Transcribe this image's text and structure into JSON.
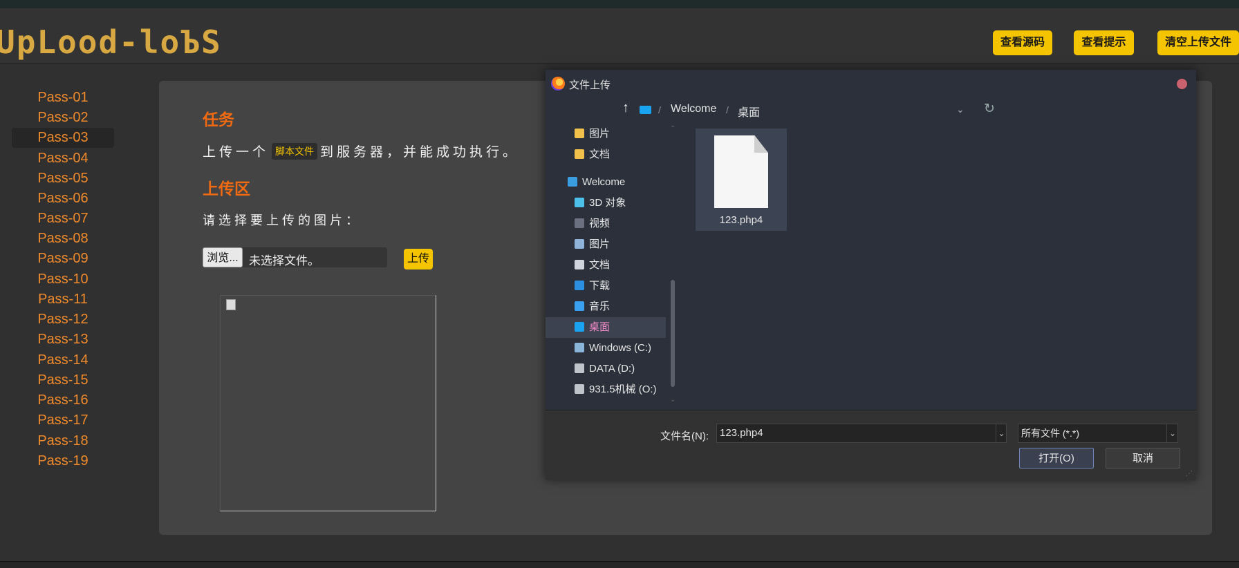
{
  "app": {
    "logo_text": "UpLood-loЪS"
  },
  "header": {
    "buttons": [
      "查看源码",
      "查看提示",
      "清空上传文件"
    ]
  },
  "sidebar": {
    "items": [
      "Pass-01",
      "Pass-02",
      "Pass-03",
      "Pass-04",
      "Pass-05",
      "Pass-06",
      "Pass-07",
      "Pass-08",
      "Pass-09",
      "Pass-10",
      "Pass-11",
      "Pass-12",
      "Pass-13",
      "Pass-14",
      "Pass-15",
      "Pass-16",
      "Pass-17",
      "Pass-18",
      "Pass-19"
    ],
    "active": "Pass-03"
  },
  "main": {
    "task_heading": "任务",
    "task_before": "上传一个",
    "task_code": "脚本文件",
    "task_after": "到服务器，并能成功执行。",
    "upload_heading": "上传区",
    "select_prompt": "请选择要上传的图片：",
    "browse_label": "浏览...",
    "file_status": "未选择文件。",
    "upload_button": "上传"
  },
  "dialog": {
    "title": "文件上传",
    "address": {
      "segments": [
        "Welcome",
        "桌面"
      ]
    },
    "nav_items": [
      {
        "label": "图片",
        "icon": "folder-icon"
      },
      {
        "label": "文档",
        "icon": "folder-icon"
      },
      {
        "label": "Welcome",
        "icon": "computer-icon"
      },
      {
        "label": "3D 对象",
        "icon": "cube-icon"
      },
      {
        "label": "视频",
        "icon": "video-icon"
      },
      {
        "label": "图片",
        "icon": "pictures-icon"
      },
      {
        "label": "文档",
        "icon": "document-icon"
      },
      {
        "label": "下载",
        "icon": "download-icon"
      },
      {
        "label": "音乐",
        "icon": "music-icon"
      },
      {
        "label": "桌面",
        "icon": "desktop-icon"
      },
      {
        "label": "Windows (C:)",
        "icon": "drive-icon"
      },
      {
        "label": "DATA (D:)",
        "icon": "drive-icon"
      },
      {
        "label": "931.5机械 (O:)",
        "icon": "drive-icon"
      }
    ],
    "selected_nav": "桌面",
    "files": [
      {
        "name": "123.php4",
        "icon": "file-icon"
      }
    ],
    "filename_label": "文件名(N):",
    "filename_value": "123.php4",
    "filetype_value": "所有文件 (*.*)",
    "open_button": "打开(O)",
    "cancel_button": "取消"
  },
  "colors": {
    "accent": "#f5c400",
    "link": "#f08a2b",
    "heading": "#f06a12",
    "logo": "#d8a943",
    "close": "#c9626e"
  }
}
